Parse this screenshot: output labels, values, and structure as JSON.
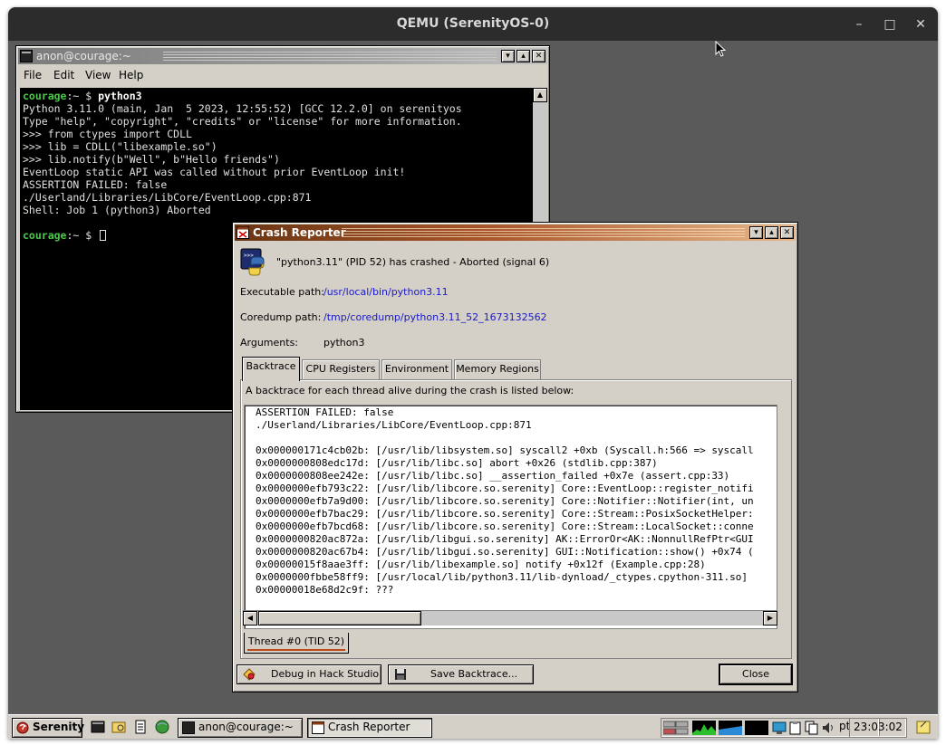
{
  "host": {
    "title": "QEMU (SerenityOS-0)",
    "minimize": "–",
    "maximize": "□",
    "close": "✕"
  },
  "terminal": {
    "title": "anon@courage:~",
    "menu": [
      "File",
      "Edit",
      "View",
      "Help"
    ],
    "prompt_user": "courage",
    "prompt_rest": ":~ $ ",
    "command": "python3",
    "output": [
      "Python 3.11.0 (main, Jan  5 2023, 12:55:52) [GCC 12.2.0] on serenityos",
      "Type \"help\", \"copyright\", \"credits\" or \"license\" for more information.",
      ">>> from ctypes import CDLL",
      ">>> lib = CDLL(\"libexample.so\")",
      ">>> lib.notify(b\"Well\", b\"Hello friends\")",
      "EventLoop static API was called without prior EventLoop init!",
      "ASSERTION FAILED: false",
      "./Userland/Libraries/LibCore/EventLoop.cpp:871",
      "Shell: Job 1 (python3) Aborted"
    ]
  },
  "crash": {
    "title": "Crash Reporter",
    "headline": "\"python3.11\" (PID 52) has crashed - Aborted (signal 6)",
    "executable_label": "Executable path:",
    "executable_value": "/usr/local/bin/python3.11",
    "coredump_label": "Coredump path:",
    "coredump_value": "/tmp/coredump/python3.11_52_1673132562",
    "arguments_label": "Arguments:",
    "arguments_value": "python3",
    "tabs": [
      "Backtrace",
      "CPU Registers",
      "Environment",
      "Memory Regions"
    ],
    "description": "A backtrace for each thread alive during the crash is listed below:",
    "backtrace": [
      "ASSERTION FAILED: false",
      "./Userland/Libraries/LibCore/EventLoop.cpp:871",
      "",
      "0x000000171c4cb02b: [/usr/lib/libsystem.so] syscall2 +0xb (Syscall.h:566 => syscall",
      "0x0000000808edc17d: [/usr/lib/libc.so] abort +0x26 (stdlib.cpp:387)",
      "0x0000000808ee242e: [/usr/lib/libc.so] __assertion_failed +0x7e (assert.cpp:33)",
      "0x0000000efb793c22: [/usr/lib/libcore.so.serenity] Core::EventLoop::register_notifi",
      "0x0000000efb7a9d00: [/usr/lib/libcore.so.serenity] Core::Notifier::Notifier(int, un",
      "0x0000000efb7bac29: [/usr/lib/libcore.so.serenity] Core::Stream::PosixSocketHelper:",
      "0x0000000efb7bcd68: [/usr/lib/libcore.so.serenity] Core::Stream::LocalSocket::conne",
      "0x0000000820ac872a: [/usr/lib/libgui.so.serenity] AK::ErrorOr<AK::NonnullRefPtr<GUI",
      "0x0000000820ac67b4: [/usr/lib/libgui.so.serenity] GUI::Notification::show() +0x74 (",
      "0x00000015f8aae3ff: [/usr/lib/libexample.so] notify +0x12f (Example.cpp:28)",
      "0x0000000fbbe58ff9: [/usr/local/lib/python3.11/lib-dynload/_ctypes.cpython-311.so]",
      "0x00000018e68d2c9f: ???"
    ],
    "thread_tab": "Thread #0 (TID 52)",
    "debug_button": "Debug in Hack Studio",
    "save_button": "Save Backtrace...",
    "close_button": "Close"
  },
  "taskbar": {
    "start": "Serenity",
    "windows": [
      "anon@courage:~",
      "Crash Reporter"
    ],
    "keymap": "pt",
    "clock": "23:03:02"
  }
}
